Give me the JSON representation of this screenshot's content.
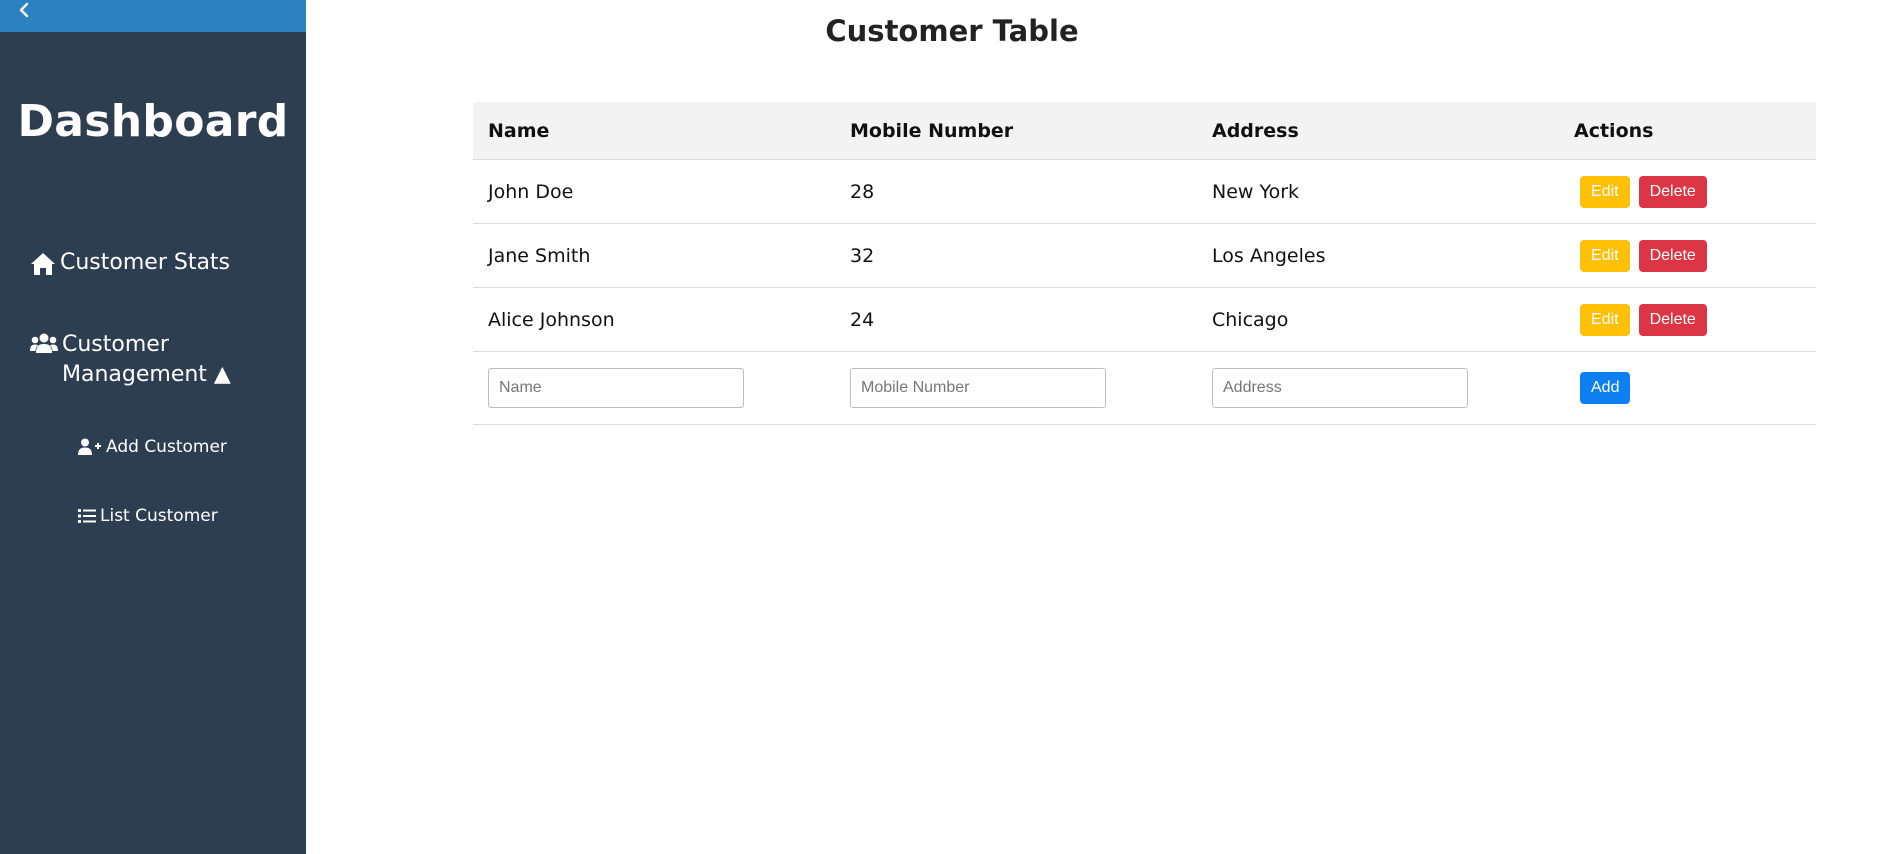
{
  "sidebar": {
    "toggle_icon": "chevron-left-icon",
    "brand": "Dashboard",
    "items": [
      {
        "label": "Customer Stats",
        "icon": "home-icon"
      },
      {
        "label": "Customer Management ▲",
        "icon": "users-icon"
      }
    ],
    "subitems": [
      {
        "label": "Add Customer",
        "icon": "user-plus-icon"
      },
      {
        "label": "List Customer",
        "icon": "list-icon"
      }
    ]
  },
  "main": {
    "title": "Customer Table",
    "table": {
      "headers": [
        "Name",
        "Mobile Number",
        "Address",
        "Actions"
      ],
      "rows": [
        {
          "name": "John Doe",
          "mobile": "28",
          "address": "New York"
        },
        {
          "name": "Jane Smith",
          "mobile": "32",
          "address": "Los Angeles"
        },
        {
          "name": "Alice Johnson",
          "mobile": "24",
          "address": "Chicago"
        }
      ],
      "edit_label": "Edit",
      "delete_label": "Delete",
      "new_row": {
        "name_placeholder": "Name",
        "mobile_placeholder": "Mobile Number",
        "address_placeholder": "Address",
        "add_label": "Add"
      }
    }
  },
  "colors": {
    "sidebar_bg": "#2c3e50",
    "toggle_bg": "#2c81c1",
    "edit": "#ffc107",
    "delete": "#dc3545",
    "add": "#0d7ff0"
  }
}
